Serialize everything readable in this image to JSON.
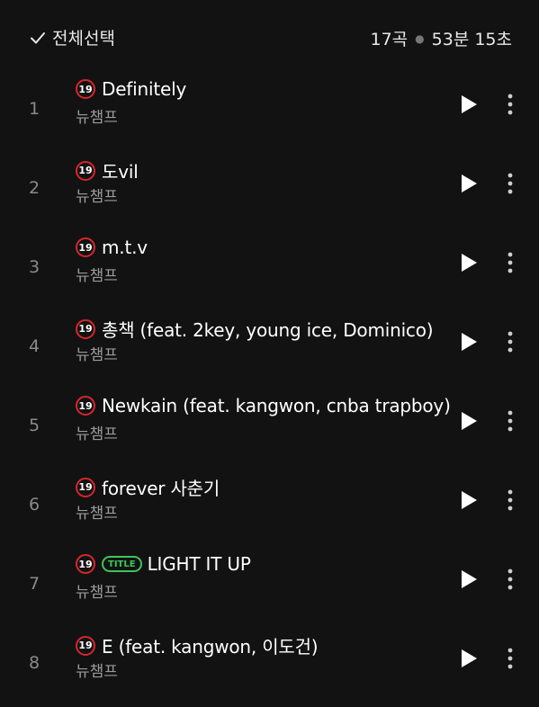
{
  "header": {
    "select_all_label": "전체선택",
    "track_count": "17곡",
    "total_duration": "53분 15초"
  },
  "colors": {
    "background": "#121212",
    "age_badge_border": "#d7262b",
    "title_badge": "#3cc55a"
  },
  "tracks": [
    {
      "index": "1",
      "age": "19",
      "title": "Definitely",
      "artist": "뉴챔프"
    },
    {
      "index": "2",
      "age": "19",
      "title": "도vil",
      "artist": "뉴챔프"
    },
    {
      "index": "3",
      "age": "19",
      "title": "m.t.v",
      "artist": "뉴챔프"
    },
    {
      "index": "4",
      "age": "19",
      "title": "총책 (feat. 2key, young ice, Dominico)",
      "artist": "뉴챔프"
    },
    {
      "index": "5",
      "age": "19",
      "title": "Newkain (feat. kangwon, cnba trapboy)",
      "artist": "뉴챔프"
    },
    {
      "index": "6",
      "age": "19",
      "title": "forever 사춘기",
      "artist": "뉴챔프"
    },
    {
      "index": "7",
      "age": "19",
      "badge": "TITLE",
      "title": "LIGHT IT UP",
      "artist": "뉴챔프"
    },
    {
      "index": "8",
      "age": "19",
      "title": "E (feat. kangwon, 이도건)",
      "artist": "뉴챔프"
    }
  ]
}
